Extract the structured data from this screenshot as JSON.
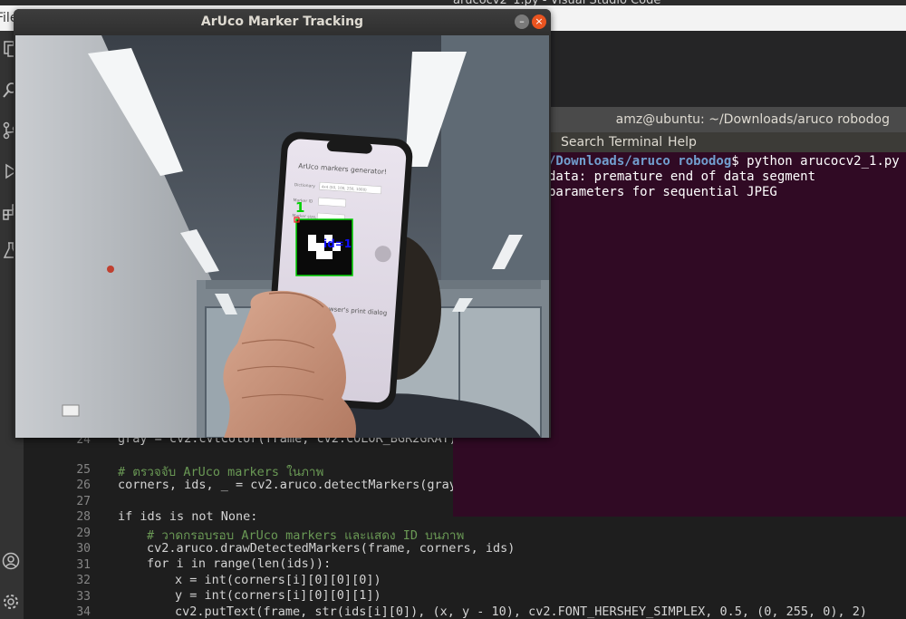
{
  "vscode": {
    "title": "arucocv2_1.py - Visual Studio Code",
    "menu_file": "File",
    "code_lines": [
      {
        "no": "24",
        "text": "gray = cv2.cvtColor(frame, cv2.COLOR_BGR2GRAY)"
      },
      {
        "no": "25",
        "text": "# ตรวจจับ ArUco markers ในภาพ"
      },
      {
        "no": "26",
        "text": "corners, ids, _ = cv2.aruco.detectMarkers(gray,"
      },
      {
        "no": "27",
        "text": ""
      },
      {
        "no": "28",
        "text": "if ids is not None:"
      },
      {
        "no": "29",
        "text": "# วาดกรอบรอบ ArUco markers และแสดง ID บนภาพ"
      },
      {
        "no": "30",
        "text": "cv2.aruco.drawDetectedMarkers(frame, corners, ids)"
      },
      {
        "no": "31",
        "text": "for i in range(len(ids)):"
      },
      {
        "no": "32",
        "text": "x = int(corners[i][0][0][0])"
      },
      {
        "no": "33",
        "text": "y = int(corners[i][0][0][1])"
      },
      {
        "no": "34",
        "text": "cv2.putText(frame, str(ids[i][0]), (x, y - 10), cv2.FONT_HERSHEY_SIMPLEX, 0.5, (0, 255, 0), 2)"
      }
    ]
  },
  "terminal": {
    "title": "amz@ubuntu: ~/Downloads/aruco robodog",
    "menu": [
      "Search",
      "Terminal",
      "Help"
    ],
    "prompt_path": "/Downloads/aruco robodog",
    "command": "$ python arucocv2_1.py",
    "output": [
      "data: premature end of data segment",
      "parameters for sequential JPEG"
    ]
  },
  "aruco_window": {
    "title": "ArUco Marker Tracking",
    "min_glyph": "–",
    "close_glyph": "×",
    "detected_id": "1",
    "id_label": "id=1",
    "phone_title": "ArUco markers generator!",
    "phone_dictionary_label": "Dictionary",
    "phone_dictionary_value": "4x4 (50, 100, 250, 1000)",
    "phone_marker_id_label": "Marker ID",
    "phone_marker_size_label": "Marker size, mm",
    "phone_footer": "Hold browser's print dialog"
  },
  "colors": {
    "vscode_bg": "#1e1e1e",
    "terminal_bg": "#300a24",
    "marker_box": "#00d000",
    "id_text": "#1010ff",
    "close_button": "#e95420"
  }
}
